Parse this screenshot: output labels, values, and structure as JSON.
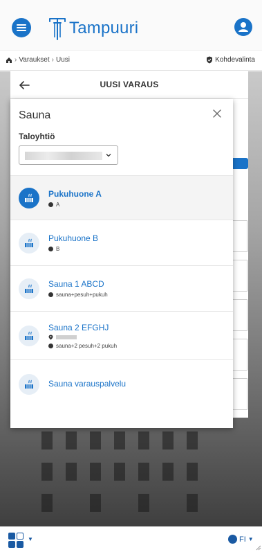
{
  "header": {
    "logo_text": "Tampuuri"
  },
  "breadcrumb": {
    "items": [
      "Varaukset",
      "Uusi"
    ],
    "target_label": "Kohdevalinta"
  },
  "modal": {
    "title": "UUSI VARAUS"
  },
  "panel": {
    "title": "Sauna",
    "taloyhtio_label": "Taloyhtiö",
    "items": [
      {
        "name": "Pukuhuone A",
        "info": "A",
        "selected": true
      },
      {
        "name": "Pukuhuone B",
        "info": "B",
        "selected": false
      },
      {
        "name": "Sauna 1 ABCD",
        "info": "sauna+pesuh+pukuh",
        "selected": false
      },
      {
        "name": "Sauna 2 EFGHJ",
        "info": "sauna+2 pesuh+2 pukuh",
        "selected": false
      },
      {
        "name": "Sauna varauspalvelu",
        "info": "",
        "selected": false
      }
    ]
  },
  "footer": {
    "language": "FI"
  },
  "colors": {
    "brand": "#1a73c8",
    "footer_icon": "#1a5aa3"
  },
  "icons": {
    "menu": "hamburger-icon",
    "user": "user-icon",
    "home": "home-icon",
    "target": "shield-icon",
    "back": "arrow-left-icon",
    "close": "close-icon",
    "item": "sauna-icon",
    "info": "info-icon",
    "location": "pin-icon",
    "language": "globe-icon"
  }
}
